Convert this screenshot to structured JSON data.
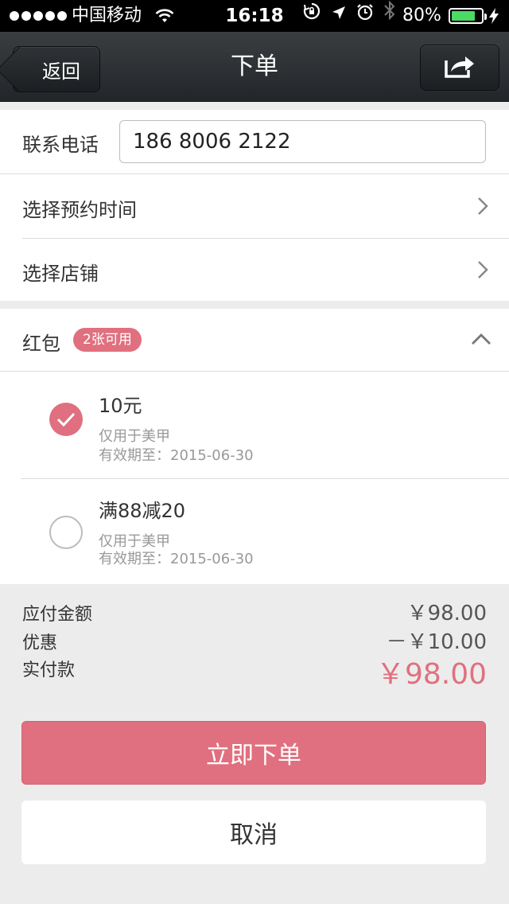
{
  "status_bar": {
    "carrier": "中国移动",
    "time": "16:18",
    "battery": "80%",
    "battery_level": 0.8,
    "icons": [
      "wifi-icon",
      "rotation-lock-icon",
      "location-arrow-icon",
      "alarm-icon",
      "bluetooth-icon",
      "charging-bolt-icon"
    ]
  },
  "nav": {
    "back_label": "返回",
    "title": "下单",
    "share_icon": "share-icon"
  },
  "form": {
    "phone_label": "联系电话",
    "phone_value": "186 8006 2122",
    "time_label": "选择预约时间",
    "store_label": "选择店铺"
  },
  "coupons": {
    "label": "红包",
    "badge": "2张可用",
    "items": [
      {
        "title": "10元",
        "scope": "仅用于美甲",
        "expiry": "有效期至：2015-06-30",
        "selected": true
      },
      {
        "title": "满88减20",
        "scope": "仅用于美甲",
        "expiry": "有效期至：2015-06-30",
        "selected": false
      }
    ]
  },
  "totals": {
    "payable_label": "应付金额",
    "payable_value": "￥98.00",
    "discount_label": "优惠",
    "discount_value": "－￥10.00",
    "actual_label": "实付款",
    "actual_value": "￥98.00"
  },
  "actions": {
    "order_label": "立即下单",
    "cancel_label": "取消"
  },
  "colors": {
    "accent": "#e0707f",
    "nav_bg": "#2a2e31",
    "page_bg": "#ececec"
  }
}
